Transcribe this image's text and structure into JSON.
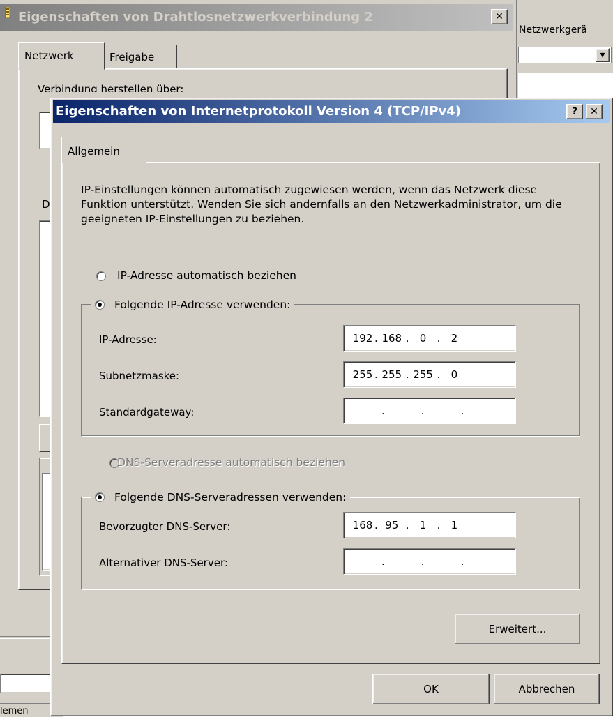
{
  "back_window": {
    "title": "Eigenschaften von Drahtlosnetzwerkverbindung 2",
    "close_symbol": "✕",
    "tabs": [
      "Netzwerk",
      "Freigabe"
    ],
    "connect_via_label": "Verbindung herstellen über:",
    "partial_letter_1": "D",
    "partial_label_bottom": "lemen"
  },
  "side_window": {
    "title": "Netzwerkgerä",
    "dropdown_arrow": "▾"
  },
  "dialog": {
    "title": "Eigenschaften von Internetprotokoll Version 4 (TCP/IPv4)",
    "help_symbol": "?",
    "close_symbol": "✕",
    "tab": "Allgemein",
    "description": "IP-Einstellungen können automatisch zugewiesen werden, wenn das Netzwerk diese Funktion unterstützt. Wenden Sie sich andernfalls an den Netzwerkadministrator, um die geeigneten IP-Einstellungen zu beziehen.",
    "ip_auto_label": "IP-Adresse automatisch beziehen",
    "ip_manual_label": "Folgende IP-Adresse verwenden:",
    "ip_address_label": "IP-Adresse:",
    "ip_address": [
      "192",
      "168",
      "0",
      "2"
    ],
    "subnet_label": "Subnetzmaske:",
    "subnet": [
      "255",
      "255",
      "255",
      "0"
    ],
    "gateway_label": "Standardgateway:",
    "gateway": [
      "",
      "",
      "",
      ""
    ],
    "dns_auto_label": "DNS-Serveradresse automatisch beziehen",
    "dns_manual_label": "Folgende DNS-Serveradressen verwenden:",
    "dns_pref_label": "Bevorzugter DNS-Server:",
    "dns_pref": [
      "168",
      "95",
      "1",
      "1"
    ],
    "dns_alt_label": "Alternativer DNS-Server:",
    "dns_alt": [
      "",
      "",
      "",
      ""
    ],
    "advanced_button": "Erweitert...",
    "ok_button": "OK",
    "cancel_button": "Abbrechen",
    "ip_selection": "manual",
    "dns_selection": "manual"
  },
  "colors": {
    "titlebar_active_start": "#0a246a",
    "titlebar_active_end": "#a6caf0",
    "titlebar_inactive_start": "#808080",
    "titlebar_inactive_end": "#c0c0c0",
    "face": "#d4d0c8"
  }
}
